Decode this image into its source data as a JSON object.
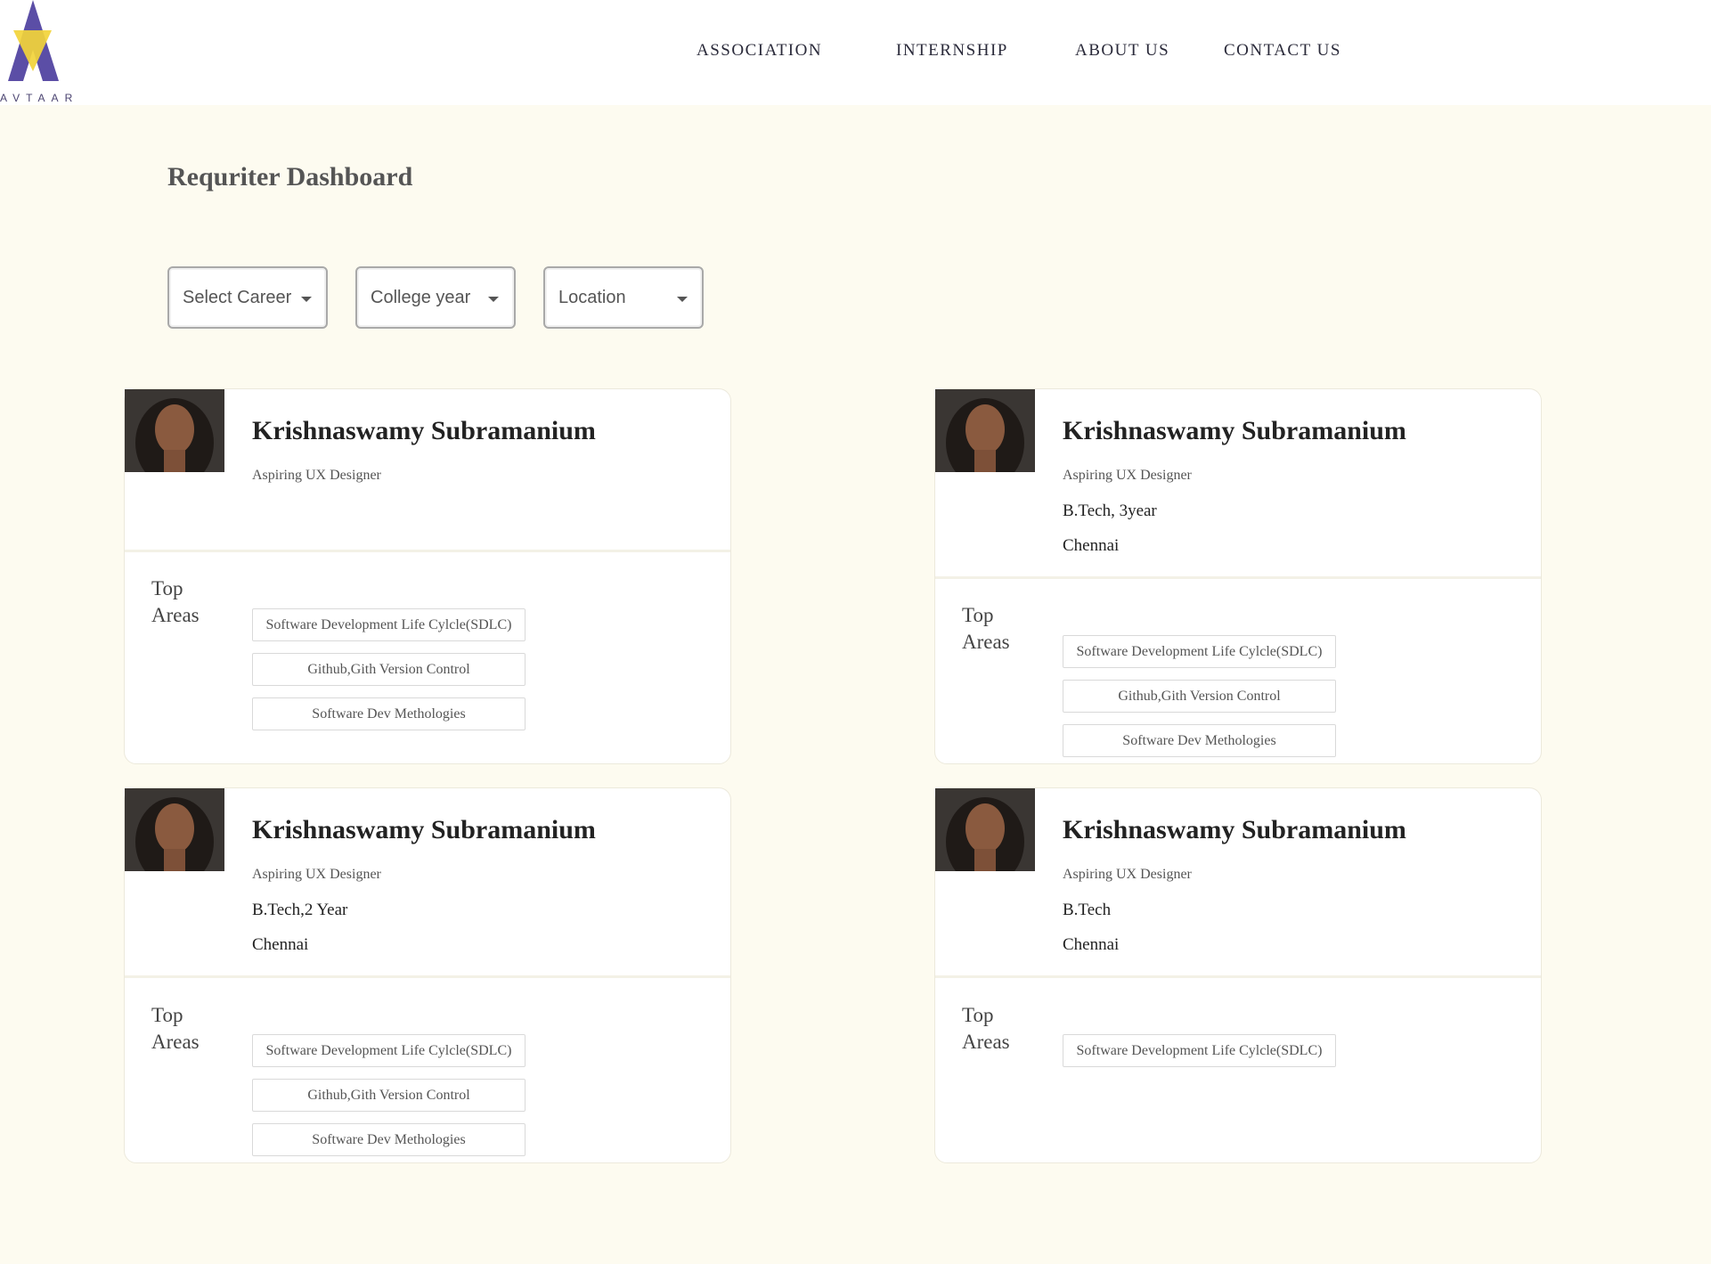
{
  "brand": {
    "name": "AVTAAR"
  },
  "nav": [
    "ASSOCIATION",
    "INTERNSHIP",
    "ABOUT US",
    "CONTACT US"
  ],
  "page_title": "Requriter Dashboard",
  "filters": [
    {
      "label": "Select Career"
    },
    {
      "label": "College year"
    },
    {
      "label": "Location"
    }
  ],
  "cards": [
    {
      "name": "Krishnaswamy Subramanium",
      "role": "Aspiring UX Designer",
      "degree": "",
      "city": "",
      "top_areas_label": "Top Areas",
      "tags": [
        "Software Development Life Cylcle(SDLC)",
        "Github,Gith Version Control",
        "Software Dev Methologies"
      ]
    },
    {
      "name": "Krishnaswamy Subramanium",
      "role": "Aspiring UX Designer",
      "degree": "B.Tech, 3year",
      "city": "Chennai",
      "top_areas_label": "Top Areas",
      "tags": [
        "Software Development Life Cylcle(SDLC)",
        "Github,Gith Version Control",
        "Software Dev Methologies"
      ]
    },
    {
      "name": "Krishnaswamy Subramanium",
      "role": "Aspiring UX Designer",
      "degree": "B.Tech,2 Year",
      "city": "Chennai",
      "top_areas_label": "Top Areas",
      "tags": [
        "Software Development Life Cylcle(SDLC)",
        "Github,Gith Version Control",
        "Software Dev Methologies"
      ]
    },
    {
      "name": "Krishnaswamy Subramanium",
      "role": "Aspiring UX Designer",
      "degree": "B.Tech",
      "city": "Chennai",
      "top_areas_label": "Top Areas",
      "tags": [
        "Software Development Life Cylcle(SDLC)"
      ]
    }
  ],
  "colors": {
    "page_bg": "#fdfbf0",
    "logo_purple": "#5b4ea6",
    "logo_yellow": "#f2d43a"
  }
}
